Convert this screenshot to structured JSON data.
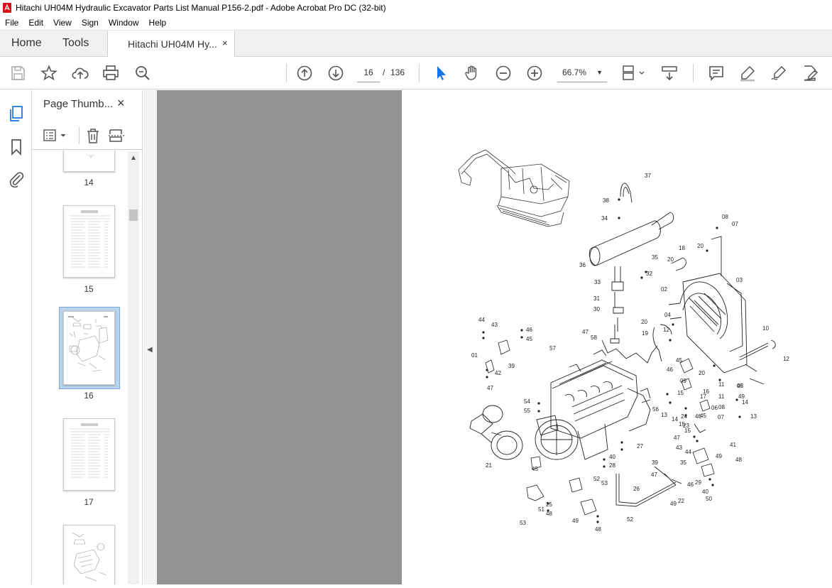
{
  "window": {
    "title": "Hitachi UH04M Hydraulic Excavator Parts List Manual P156-2.pdf - Adobe Acrobat Pro DC (32-bit)"
  },
  "menu": [
    "File",
    "Edit",
    "View",
    "Sign",
    "Window",
    "Help"
  ],
  "tabs": {
    "home": "Home",
    "tools": "Tools",
    "document": "Hitachi UH04M Hy...",
    "close": "×"
  },
  "toolbar": {
    "icons": [
      "save-icon",
      "star-icon",
      "upload-icon",
      "print-icon",
      "zoom-search-icon",
      "page-up-icon",
      "page-down-icon",
      "select-arrow-icon",
      "hand-icon",
      "zoom-out-icon",
      "zoom-in-icon",
      "fit-page-icon",
      "scroll-mode-icon",
      "comment-icon",
      "highlight-icon",
      "sign-icon",
      "edit-pdf-icon"
    ],
    "current_page": "16",
    "page_separator": "/",
    "total_pages": "136",
    "zoom": "66.7%"
  },
  "thumbnail_panel": {
    "title": "Page Thumb...",
    "close": "×",
    "pages": [
      "14",
      "15",
      "16",
      "17"
    ],
    "selected_page": "16"
  },
  "diagram": {
    "callouts": [
      "37",
      "38",
      "34",
      "08",
      "07",
      "36",
      "35",
      "32",
      "18",
      "20",
      "20",
      "33",
      "02",
      "03",
      "31",
      "30",
      "04",
      "20",
      "12",
      "19",
      "10",
      "44",
      "43",
      "46",
      "45",
      "47",
      "58",
      "57",
      "01",
      "39",
      "42",
      "47",
      "45",
      "46",
      "20",
      "17",
      "12",
      "09",
      "11",
      "15",
      "16",
      "11",
      "05",
      "49",
      "48",
      "54",
      "55",
      "56",
      "13",
      "14",
      "24",
      "23",
      "08",
      "07",
      "14",
      "13",
      "15",
      "15",
      "46",
      "45",
      "06",
      "47",
      "43",
      "41",
      "44",
      "35",
      "49",
      "48",
      "27",
      "40",
      "28",
      "39",
      "45",
      "47",
      "46",
      "29",
      "40",
      "50",
      "21",
      "52",
      "53",
      "26",
      "25",
      "48",
      "49",
      "22",
      "51",
      "52",
      "53",
      "48",
      "49"
    ]
  }
}
